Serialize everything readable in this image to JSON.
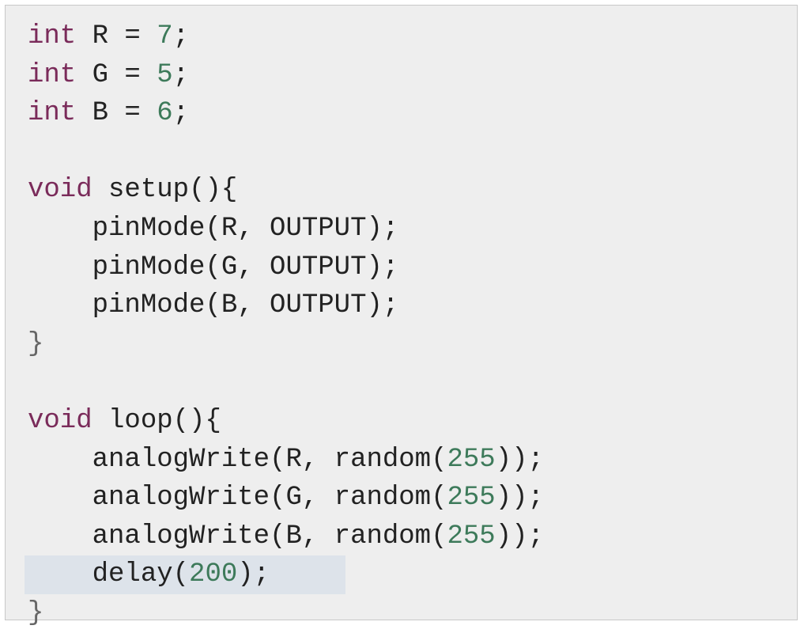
{
  "code": {
    "lines": [
      [
        {
          "t": "int",
          "c": "kw"
        },
        {
          "t": " R = ",
          "c": "plain"
        },
        {
          "t": "7",
          "c": "num"
        },
        {
          "t": ";",
          "c": "plain"
        }
      ],
      [
        {
          "t": "int",
          "c": "kw"
        },
        {
          "t": " G = ",
          "c": "plain"
        },
        {
          "t": "5",
          "c": "num"
        },
        {
          "t": ";",
          "c": "plain"
        }
      ],
      [
        {
          "t": "int",
          "c": "kw"
        },
        {
          "t": " B = ",
          "c": "plain"
        },
        {
          "t": "6",
          "c": "num"
        },
        {
          "t": ";",
          "c": "plain"
        }
      ],
      [],
      [
        {
          "t": "void",
          "c": "kw"
        },
        {
          "t": " setup(){",
          "c": "plain"
        }
      ],
      [
        {
          "t": "    pinMode(R, OUTPUT);",
          "c": "plain"
        }
      ],
      [
        {
          "t": "    pinMode(G, OUTPUT);",
          "c": "plain"
        }
      ],
      [
        {
          "t": "    pinMode(B, OUTPUT);",
          "c": "plain"
        }
      ],
      [
        {
          "t": "}",
          "c": "brace"
        }
      ],
      [],
      [
        {
          "t": "void",
          "c": "kw"
        },
        {
          "t": " loop(){",
          "c": "plain"
        }
      ],
      [
        {
          "t": "    analogWrite(R, random(",
          "c": "plain"
        },
        {
          "t": "255",
          "c": "num"
        },
        {
          "t": "));",
          "c": "plain"
        }
      ],
      [
        {
          "t": "    analogWrite(G, random(",
          "c": "plain"
        },
        {
          "t": "255",
          "c": "num"
        },
        {
          "t": "));",
          "c": "plain"
        }
      ],
      [
        {
          "t": "    analogWrite(B, random(",
          "c": "plain"
        },
        {
          "t": "255",
          "c": "num"
        },
        {
          "t": "));",
          "c": "plain"
        }
      ],
      [
        {
          "t": "    delay(",
          "c": "plain"
        },
        {
          "t": "200",
          "c": "num"
        },
        {
          "t": ");",
          "c": "plain"
        }
      ],
      [
        {
          "t": "}",
          "c": "brace"
        }
      ]
    ],
    "highlighted_line": 14
  },
  "colors": {
    "background": "#eeeeee",
    "keyword": "#7a2b5a",
    "number": "#3d7a5a",
    "text": "#222222",
    "line_highlight": "#dde3ea"
  }
}
